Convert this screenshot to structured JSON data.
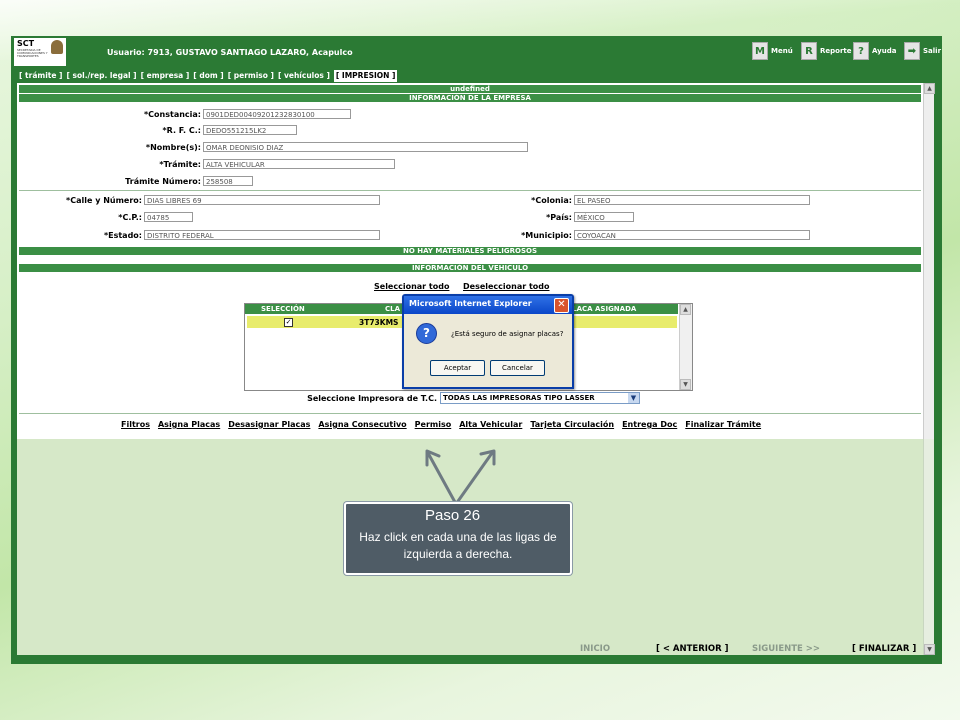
{
  "header": {
    "logo_text": "SCT",
    "logo_subtitle": "SECRETARÍA DE COMUNICACIONES Y TRANSPORTES",
    "user_label": "Usuario: 7913, GUSTAVO SANTIAGO LAZARO, Acapulco"
  },
  "toolbar": {
    "menu": {
      "icon": "M",
      "label": "Menú"
    },
    "reporte": {
      "icon": "R",
      "label": "Reporte"
    },
    "ayuda": {
      "icon": "?",
      "label": "Ayuda"
    },
    "salir": {
      "icon": "➡",
      "label": "Salir"
    }
  },
  "tabs": [
    "[ trámite ]",
    "[ sol./rep. legal ]",
    "[ empresa ]",
    "[ dom ]",
    "[ permiso ]",
    "[ vehículos ]",
    "[ IMPRESION ]"
  ],
  "form": {
    "undefined_bar": "undefined",
    "empresa_header": "INFORMACIÓN DE LA EMPRESA",
    "constancia": {
      "label": "*Constancia:",
      "value": "0901DED00409201232830100"
    },
    "rfc": {
      "label": "*R. F. C.:",
      "value": "DEDO551215LK2"
    },
    "nombre": {
      "label": "*Nombre(s):",
      "value": "OMAR DEONISIO DIAZ"
    },
    "tramite": {
      "label": "*Trámite:",
      "value": "ALTA VEHICULAR"
    },
    "tramite_numero": {
      "label": "Trámite Número:",
      "value": "258508"
    },
    "calle": {
      "label": "*Calle y Número:",
      "value": "DIAS LIBRES 69"
    },
    "colonia": {
      "label": "*Colonia:",
      "value": "EL PASEO"
    },
    "cp": {
      "label": "*C.P.:",
      "value": "04785"
    },
    "pais": {
      "label": "*País:",
      "value": "MÉXICO"
    },
    "estado": {
      "label": "*Estado:",
      "value": "DISTRITO FEDERAL"
    },
    "municipio": {
      "label": "*Municipio:",
      "value": "COYOACAN"
    },
    "materiales_bar": "NO HAY MATERIALES PELIGROSOS",
    "vehiculo_header": "INFORMACIÓN DEL VEHICULO",
    "select_all": "Seleccionar todo",
    "deselect_all": "Deseleccionar todo",
    "table": {
      "col_seleccion": "SELECCIÓN",
      "col_clave": "CLA",
      "col_placa": "PLACA ASIGNADA",
      "row_clave": "3T73KMS",
      "row_checked": true
    },
    "impresora_label": "Seleccione Impresora de T.C.",
    "impresora_value": "TODAS LAS IMPRESORAS TIPO LASSER"
  },
  "actions": [
    "Filtros",
    "Asigna Placas",
    "Desasignar Placas",
    "Asigna Consecutivo",
    "Permiso",
    "Alta Vehicular",
    "Tarjeta Circulación",
    "Entrega Doc",
    "Finalizar Trámite"
  ],
  "bottom_nav": {
    "inicio": "INICIO",
    "anterior": "[ < ANTERIOR ]",
    "siguiente": "SIGUIENTE >>",
    "finalizar": "[ FINALIZAR ]"
  },
  "dialog": {
    "title": "Microsoft Internet Explorer",
    "icon": "question-icon",
    "message": "¿Está seguro de asignar placas?",
    "ok": "Aceptar",
    "cancel": "Cancelar"
  },
  "callout": {
    "title": "Paso 26",
    "text": "Haz click en cada una de las ligas de izquierda a derecha."
  }
}
